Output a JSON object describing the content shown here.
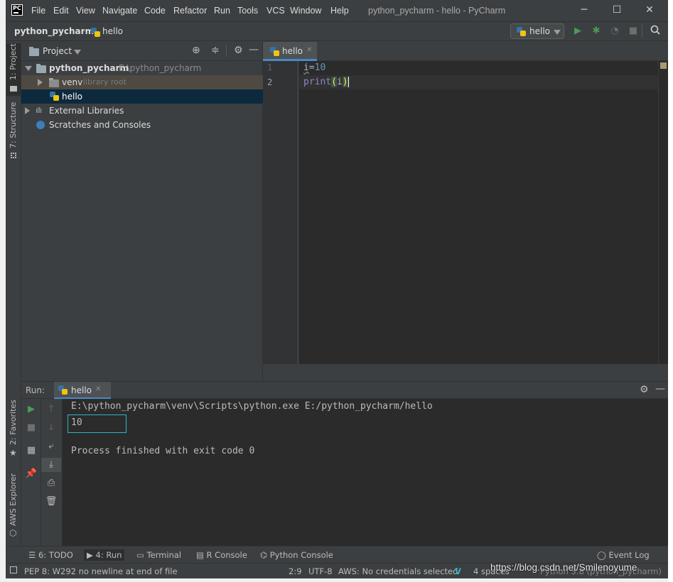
{
  "window": {
    "title": "python_pycharm - hello - PyCharm",
    "logo": "PC",
    "minimize": "─",
    "maximize": "☐",
    "close": "✕"
  },
  "menu": [
    "File",
    "Edit",
    "View",
    "Navigate",
    "Code",
    "Refactor",
    "Run",
    "Tools",
    "VCS",
    "Window",
    "Help"
  ],
  "navbar": {
    "root": "python_pycharm",
    "file": "hello",
    "run_config": "hello"
  },
  "left_stripe": {
    "project": "1: Project",
    "structure": "7: Structure",
    "favorites": "2: Favorites",
    "aws": "AWS Explorer"
  },
  "project_panel": {
    "title": "Project",
    "tree": {
      "root_name": "python_pycharm",
      "root_path": "E:\\python_pycharm",
      "venv": "venv",
      "venv_hint": "library root",
      "file": "hello",
      "external": "External Libraries",
      "scratches": "Scratches and Consoles"
    }
  },
  "editor": {
    "tab": "hello",
    "line_numbers": [
      "1",
      "2"
    ],
    "code": {
      "l1_var": "i",
      "l1_eq": "=",
      "l1_num": "10",
      "l2_fn": "print",
      "l2_open": "(",
      "l2_arg": "i",
      "l2_close": ")"
    }
  },
  "run": {
    "label": "Run:",
    "tab": "hello",
    "console": [
      "E:\\python_pycharm\\venv\\Scripts\\python.exe E:/python_pycharm/hello",
      "10",
      "",
      "Process finished with exit code 0"
    ]
  },
  "bottom_tabs": {
    "todo": "6: TODO",
    "run": "4: Run",
    "terminal": "Terminal",
    "rconsole": "R Console",
    "pyconsole": "Python Console",
    "eventlog": "Event Log"
  },
  "status": {
    "message": "PEP 8: W292 no newline at end of file",
    "position": "2:9",
    "encoding": "UTF-8",
    "aws": "AWS: No credentials selected",
    "indent": "4 spaces",
    "interpreter": "Python 3.8 (python_pycharm)"
  },
  "watermark": "https://blog.csdn.net/Smilenoyume",
  "colors": {
    "background": "#3c3f41",
    "editor": "#2b2b2b",
    "accent": "#4a88c7",
    "keyword": "#8888c6",
    "number": "#6897bb",
    "run_green": "#499c54"
  }
}
